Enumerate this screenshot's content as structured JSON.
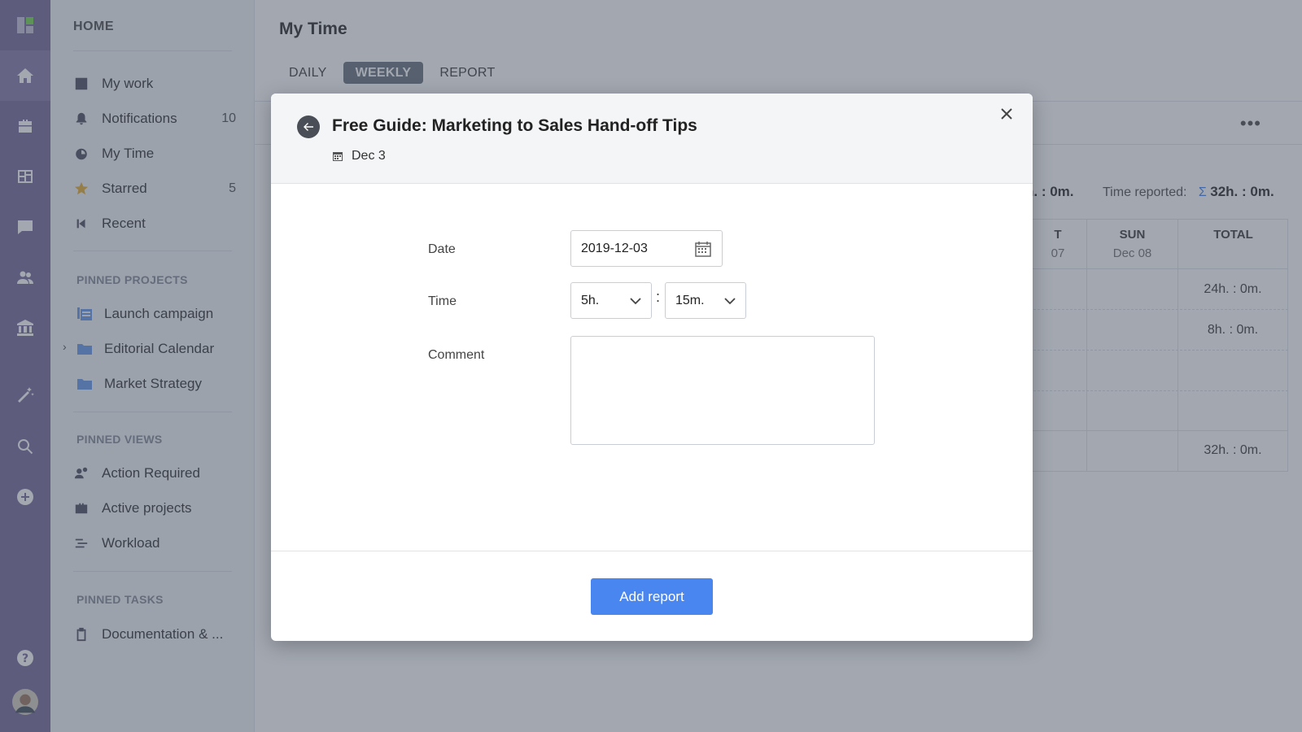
{
  "sidebar": {
    "home_label": "HOME",
    "items": [
      {
        "label": "My work",
        "icon": "checkbox-icon"
      },
      {
        "label": "Notifications",
        "icon": "bell-icon",
        "count": "10"
      },
      {
        "label": "My Time",
        "icon": "stopwatch-icon"
      },
      {
        "label": "Starred",
        "icon": "star-icon",
        "count": "5"
      },
      {
        "label": "Recent",
        "icon": "recent-icon"
      }
    ],
    "pinned_projects_label": "PINNED PROJECTS",
    "projects": [
      {
        "label": "Launch campaign"
      },
      {
        "label": "Editorial Calendar"
      },
      {
        "label": "Market Strategy"
      }
    ],
    "pinned_views_label": "PINNED VIEWS",
    "views": [
      {
        "label": "Action Required"
      },
      {
        "label": "Active projects"
      },
      {
        "label": "Workload"
      }
    ],
    "pinned_tasks_label": "PINNED TASKS",
    "tasks": [
      {
        "label": "Documentation & ..."
      }
    ]
  },
  "main": {
    "title": "My Time",
    "tabs": [
      {
        "label": "DAILY"
      },
      {
        "label": "WEEKLY",
        "active": true
      },
      {
        "label": "REPORT"
      }
    ],
    "summary_partial": "h. : 0m.",
    "time_reported_label": "Time reported:",
    "time_reported_symbol": "Σ",
    "time_reported_value": "32h. : 0m.",
    "grid": {
      "sat_header": "T",
      "sat_sub": "07",
      "sun_header": "SUN",
      "sun_sub": "Dec 08",
      "total_header": "TOTAL",
      "totals": [
        "24h. : 0m.",
        "8h. : 0m.",
        "",
        "",
        "32h. : 0m."
      ]
    }
  },
  "modal": {
    "title": "Free Guide: Marketing to Sales Hand-off Tips",
    "date_badge": "Dec 3",
    "date_label": "Date",
    "date_value": "2019-12-03",
    "time_label": "Time",
    "hours_value": "5h.",
    "minutes_value": "15m.",
    "time_separator": ":",
    "comment_label": "Comment",
    "comment_value": "",
    "submit_label": "Add report"
  },
  "colors": {
    "rail": "#7b6f9e",
    "primary_button": "#4a86f0",
    "active_tab": "#6f7780"
  }
}
